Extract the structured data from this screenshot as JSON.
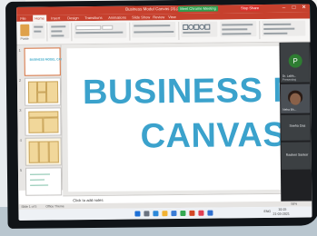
{
  "window": {
    "title": "Business Model Canvas (3).p...",
    "meet_bar": "Meet Chrome Meeting",
    "stop_share": "Stop Share",
    "controls": [
      "–",
      "□",
      "✕"
    ]
  },
  "ribbon_tabs": [
    "File",
    "Home",
    "Insert",
    "Design",
    "Transitions",
    "Animations",
    "Slide Show",
    "Review",
    "View"
  ],
  "ribbon": {
    "paste_label": "Paste",
    "groups": [
      "Clipboard",
      "Slides",
      "Font",
      "Paragraph",
      "Drawing",
      "Editing"
    ]
  },
  "thumbnails": [
    {
      "num": "1",
      "title": "BUSINESS MODEL CANVAS"
    },
    {
      "num": "2",
      "title": ""
    },
    {
      "num": "3",
      "title": ""
    },
    {
      "num": "4",
      "title": ""
    },
    {
      "num": "5",
      "title": ""
    }
  ],
  "slide": {
    "line1": "BUSINESS MODEL",
    "line2": "CANVAS"
  },
  "notes_placeholder": "Click to add notes",
  "status": {
    "slide_of": "Slide 1 of 5",
    "theme": "Office Theme",
    "zoom": "58%"
  },
  "meet": {
    "presenter_initial": "P",
    "participants": [
      {
        "name": "Dr. Lalith...",
        "sub": "Presenting"
      },
      {
        "name": "Neha Bh...",
        "sub": ""
      },
      {
        "name": "Sneha Das",
        "sub": ""
      },
      {
        "name": "Rashmi Sankar",
        "sub": ""
      }
    ]
  },
  "taskbar": {
    "time": "10:15",
    "date": "21-03-2021",
    "lang": "ENG"
  },
  "colors": {
    "accent": "#c6402d",
    "title_text": "#3ba2cc",
    "meet_green": "#2f9e4f"
  }
}
